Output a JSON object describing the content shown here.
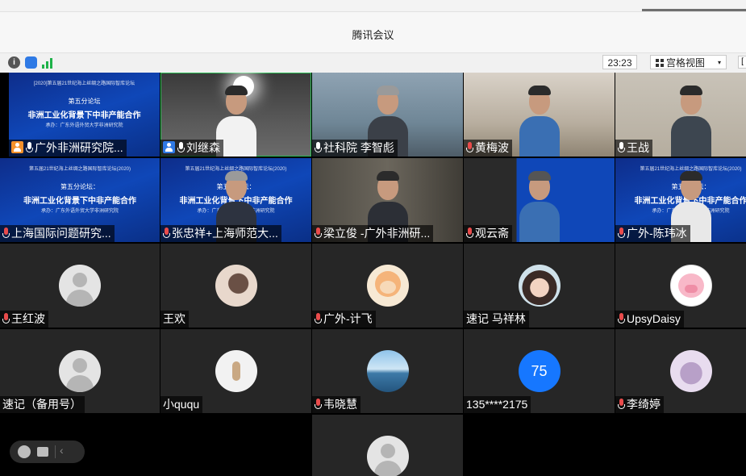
{
  "window": {
    "title": "腾讯会议"
  },
  "toolbar": {
    "timer": "23:23",
    "view_label": "宫格视图",
    "view_dropdown": "▾",
    "info_icon": "i"
  },
  "participants": [
    {
      "name": "广外非洲研究院...",
      "tag": "host",
      "mic": "on",
      "banner": {
        "l1": "[2020]第五届21世纪海上丝绸之路国际智库论坛",
        "l2": "第五分论坛",
        "l3": "非洲工业化背景下中非产能合作",
        "l4": "承办：广东外语外贸大学非洲研究院"
      }
    },
    {
      "name": "刘继森",
      "tag": "cohost",
      "mic": "on"
    },
    {
      "name": "社科院 李智彪",
      "mic": "on"
    },
    {
      "name": "黄梅波",
      "mic": "off"
    },
    {
      "name": "王战",
      "mic": "on"
    },
    {
      "name": "上海国际问题研究...",
      "mic": "off",
      "banner": {
        "l1": "第五届21世纪海上丝绸之路国际智库论坛(2020)",
        "l2": "第五分论坛：",
        "l3": "非洲工业化背景下中非产能合作",
        "l4": "承办：广东外语外贸大学非洲研究院"
      }
    },
    {
      "name": "张忠祥+上海师范大...",
      "mic": "off",
      "banner": {
        "l1": "第五届21世纪海上丝绸之路国际智库论坛(2020)",
        "l2": "第五分论坛：",
        "l3": "非洲工业化背景下中非产能合作",
        "l4": "承办：广东外语外贸大学非洲研究院"
      }
    },
    {
      "name": "梁立俊 -广外非洲研...",
      "mic": "off"
    },
    {
      "name": "观云斋",
      "mic": "off"
    },
    {
      "name": "广外-陈玮冰",
      "mic": "off",
      "banner": {
        "l1": "第五届21世纪海上丝绸之路国际智库论坛(2020)",
        "l2": "第五分论坛：",
        "l3": "非洲工业化背景下中非产能合作",
        "l4": "承办：广东外语外贸大学非洲研究院"
      }
    },
    {
      "name": "王红波",
      "mic": "off"
    },
    {
      "name": "王欢",
      "mic": "none"
    },
    {
      "name": "广外-计飞",
      "mic": "off"
    },
    {
      "name": "速记 马祥林",
      "mic": "none"
    },
    {
      "name": "UpsyDaisy",
      "mic": "off"
    },
    {
      "name": "速记（备用号）",
      "mic": "none"
    },
    {
      "name": "小ququ",
      "mic": "none"
    },
    {
      "name": "韦晓慧",
      "mic": "off"
    },
    {
      "name": "135****2175",
      "mic": "none",
      "avatar_text": "75"
    },
    {
      "name": "李绮婷",
      "mic": "off"
    }
  ],
  "colors": {
    "accent": "#1677ff",
    "host_tag": "#f4912b",
    "active_border": "#2bbd55",
    "muted": "#e94b4b"
  }
}
